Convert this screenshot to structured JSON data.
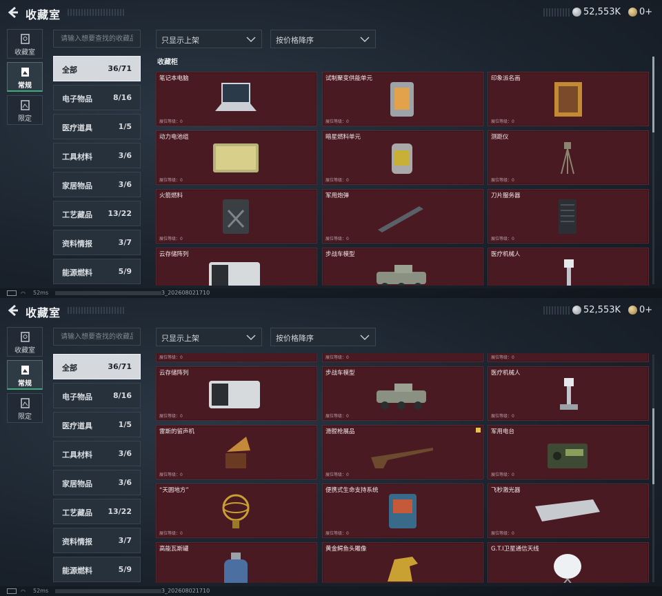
{
  "header": {
    "title": "收藏室",
    "currency_silver": "52,553K",
    "currency_gold": "0+"
  },
  "side_tabs": [
    {
      "label": "收藏室",
      "icon": "vault-icon"
    },
    {
      "label": "常规",
      "icon": "frame-icon"
    },
    {
      "label": "限定",
      "icon": "limited-icon"
    }
  ],
  "search": {
    "placeholder": "请输入想要查找的收藏品"
  },
  "filters": {
    "display_filter": "只显示上架",
    "sort_order": "按价格降序"
  },
  "categories": [
    {
      "name": "全部",
      "count": "36/71"
    },
    {
      "name": "电子物品",
      "count": "8/16"
    },
    {
      "name": "医疗道具",
      "count": "1/5"
    },
    {
      "name": "工具材料",
      "count": "3/6"
    },
    {
      "name": "家居物品",
      "count": "3/6"
    },
    {
      "name": "工艺藏品",
      "count": "13/22"
    },
    {
      "name": "资料情报",
      "count": "3/7"
    },
    {
      "name": "能源燃料",
      "count": "5/9"
    }
  ],
  "shelf_title": "收藏柜",
  "level_label": "展位等级：0",
  "items_panel1": [
    {
      "name": "笔记本电脑",
      "art": "laptop-icon"
    },
    {
      "name": "试制聚变供能单元",
      "art": "fusion-cell-icon"
    },
    {
      "name": "印象派名画",
      "art": "painting-icon"
    },
    {
      "name": "动力电池组",
      "art": "battery-pack-icon"
    },
    {
      "name": "暗星燃料单元",
      "art": "fuel-canister-icon"
    },
    {
      "name": "测距仪",
      "art": "rangefinder-icon"
    },
    {
      "name": "火箭燃料",
      "art": "jerrycan-icon"
    },
    {
      "name": "军用炮弹",
      "art": "shell-icon"
    },
    {
      "name": "刀片服务器",
      "art": "server-icon"
    },
    {
      "name": "云存储阵列",
      "art": "storage-array-icon"
    },
    {
      "name": "步战车模型",
      "art": "ifv-model-icon"
    },
    {
      "name": "医疗机械人",
      "art": "medical-robot-icon"
    }
  ],
  "items_panel2": [
    {
      "name": "云存储阵列",
      "art": "storage-array-icon"
    },
    {
      "name": "步战车模型",
      "art": "ifv-model-icon"
    },
    {
      "name": "医疗机械人",
      "art": "medical-robot-icon"
    },
    {
      "name": "雷斯的留声机",
      "art": "gramophone-icon"
    },
    {
      "name": "滑膛枪展品",
      "art": "musket-icon",
      "badge": true
    },
    {
      "name": "军用电台",
      "art": "radio-icon"
    },
    {
      "name": "“天圆地方”",
      "art": "armillary-icon"
    },
    {
      "name": "便携式生命支持系统",
      "art": "life-support-icon"
    },
    {
      "name": "飞秒激光器",
      "art": "laser-icon"
    },
    {
      "name": "高能瓦斯罐",
      "art": "gas-tank-icon"
    },
    {
      "name": "黄金鳄鱼头雕像",
      "art": "croc-statue-icon"
    },
    {
      "name": "G.T.I卫星通信天线",
      "art": "satellite-dish-icon"
    }
  ],
  "status": {
    "ping": "52ms",
    "build": "3_202608021710"
  },
  "colors": {
    "card_bg": "#4a1a22",
    "active_tab_accent": "#3fae7a",
    "active_category_bg": "#d5d9dd"
  }
}
